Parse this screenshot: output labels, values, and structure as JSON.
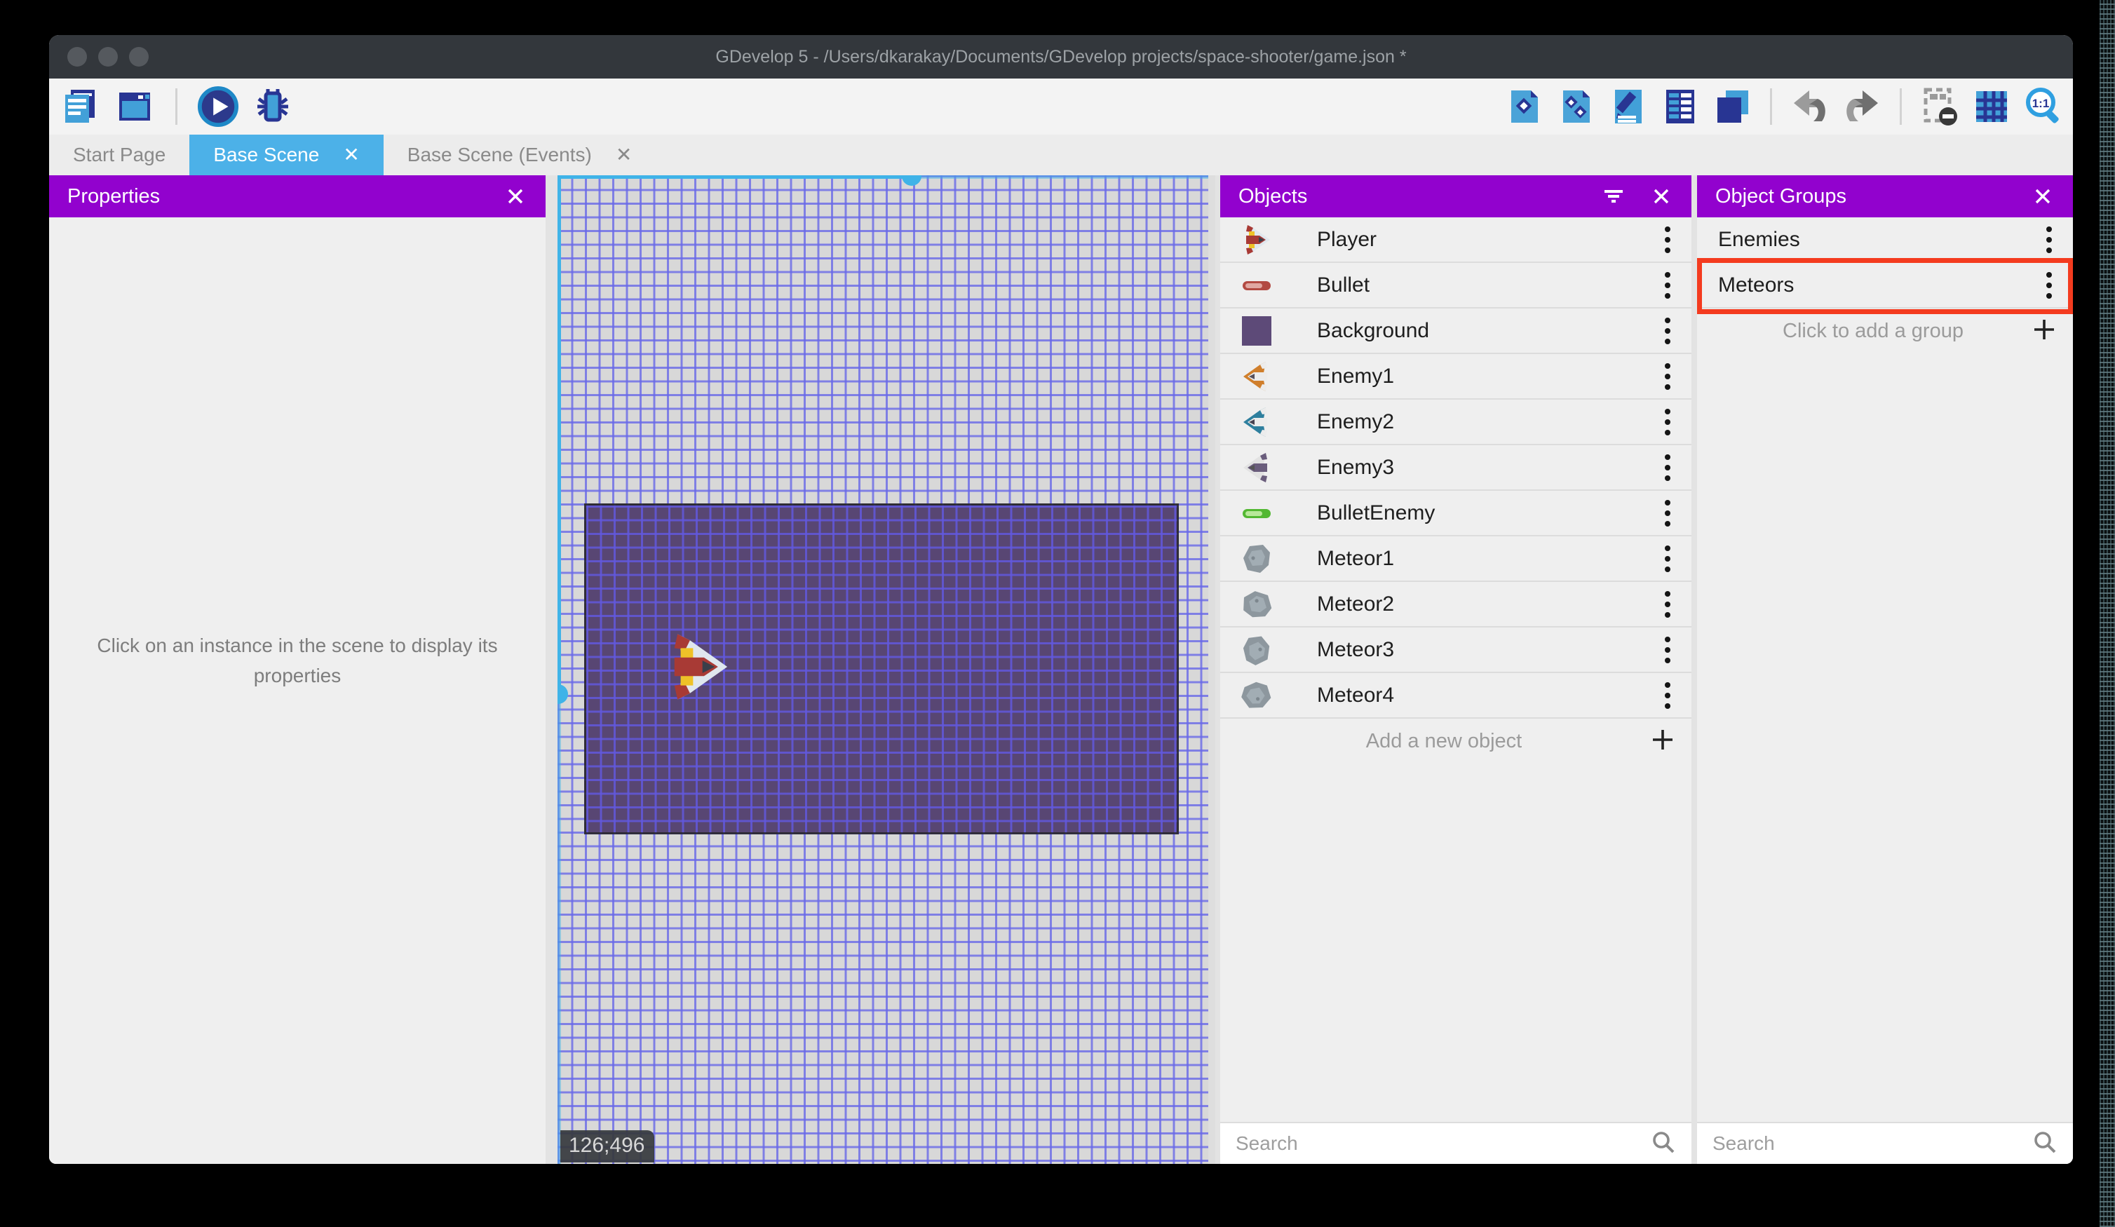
{
  "window": {
    "title": "GDevelop 5 - /Users/dkarakay/Documents/GDevelop projects/space-shooter/game.json *"
  },
  "toolbar": {
    "left_icons": [
      "project-manager-icon",
      "start-page-window-icon",
      "play-preview-icon",
      "debug-icon"
    ],
    "right_icons": [
      "objects-editor-icon",
      "object-groups-editor-icon",
      "properties-editor-icon",
      "instances-list-icon",
      "layers-editor-icon",
      "undo-icon",
      "redo-icon",
      "window-mask-icon",
      "grid-icon",
      "zoom-1-1-icon"
    ]
  },
  "tabs": [
    {
      "label": "Start Page",
      "active": false,
      "closable": false
    },
    {
      "label": "Base Scene",
      "active": true,
      "closable": true
    },
    {
      "label": "Base Scene (Events)",
      "active": false,
      "closable": true
    }
  ],
  "properties_panel": {
    "title": "Properties",
    "empty_message": "Click on an instance in the scene to display its properties"
  },
  "scene": {
    "coordinates": "126;496"
  },
  "objects_panel": {
    "title": "Objects",
    "header_icons": [
      "filter-icon",
      "close-icon"
    ],
    "objects": [
      {
        "name": "Player",
        "thumb": "ship-player"
      },
      {
        "name": "Bullet",
        "thumb": "bullet-red"
      },
      {
        "name": "Background",
        "thumb": "square-purple"
      },
      {
        "name": "Enemy1",
        "thumb": "ship-orange"
      },
      {
        "name": "Enemy2",
        "thumb": "ship-teal"
      },
      {
        "name": "Enemy3",
        "thumb": "ship-gray"
      },
      {
        "name": "BulletEnemy",
        "thumb": "bullet-green"
      },
      {
        "name": "Meteor1",
        "thumb": "meteor1"
      },
      {
        "name": "Meteor2",
        "thumb": "meteor2"
      },
      {
        "name": "Meteor3",
        "thumb": "meteor3"
      },
      {
        "name": "Meteor4",
        "thumb": "meteor4"
      }
    ],
    "add_label": "Add a new object",
    "search_placeholder": "Search"
  },
  "groups_panel": {
    "title": "Object Groups",
    "groups": [
      {
        "name": "Enemies",
        "highlighted": false
      },
      {
        "name": "Meteors",
        "highlighted": true
      }
    ],
    "add_label": "Click to add a group",
    "search_placeholder": "Search"
  },
  "colors": {
    "accent_purple": "#9202ce",
    "active_tab_blue": "#4cb1e8",
    "selection_cyan": "#3fb3e8",
    "annotation_red": "#f43b1f",
    "background_object_purple": "#584673"
  }
}
